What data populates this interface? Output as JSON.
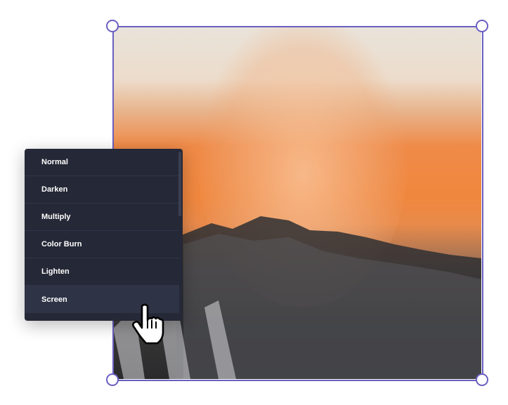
{
  "menu": {
    "items": [
      {
        "label": "Normal"
      },
      {
        "label": "Darken"
      },
      {
        "label": "Multiply"
      },
      {
        "label": "Color Burn"
      },
      {
        "label": "Lighten"
      },
      {
        "label": "Screen",
        "active": true
      }
    ]
  },
  "colors": {
    "selection": "#6a5fc1",
    "menu_bg": "#252836",
    "menu_active": "#2f3346"
  },
  "icons": {
    "cursor": "hand-pointer-icon"
  }
}
